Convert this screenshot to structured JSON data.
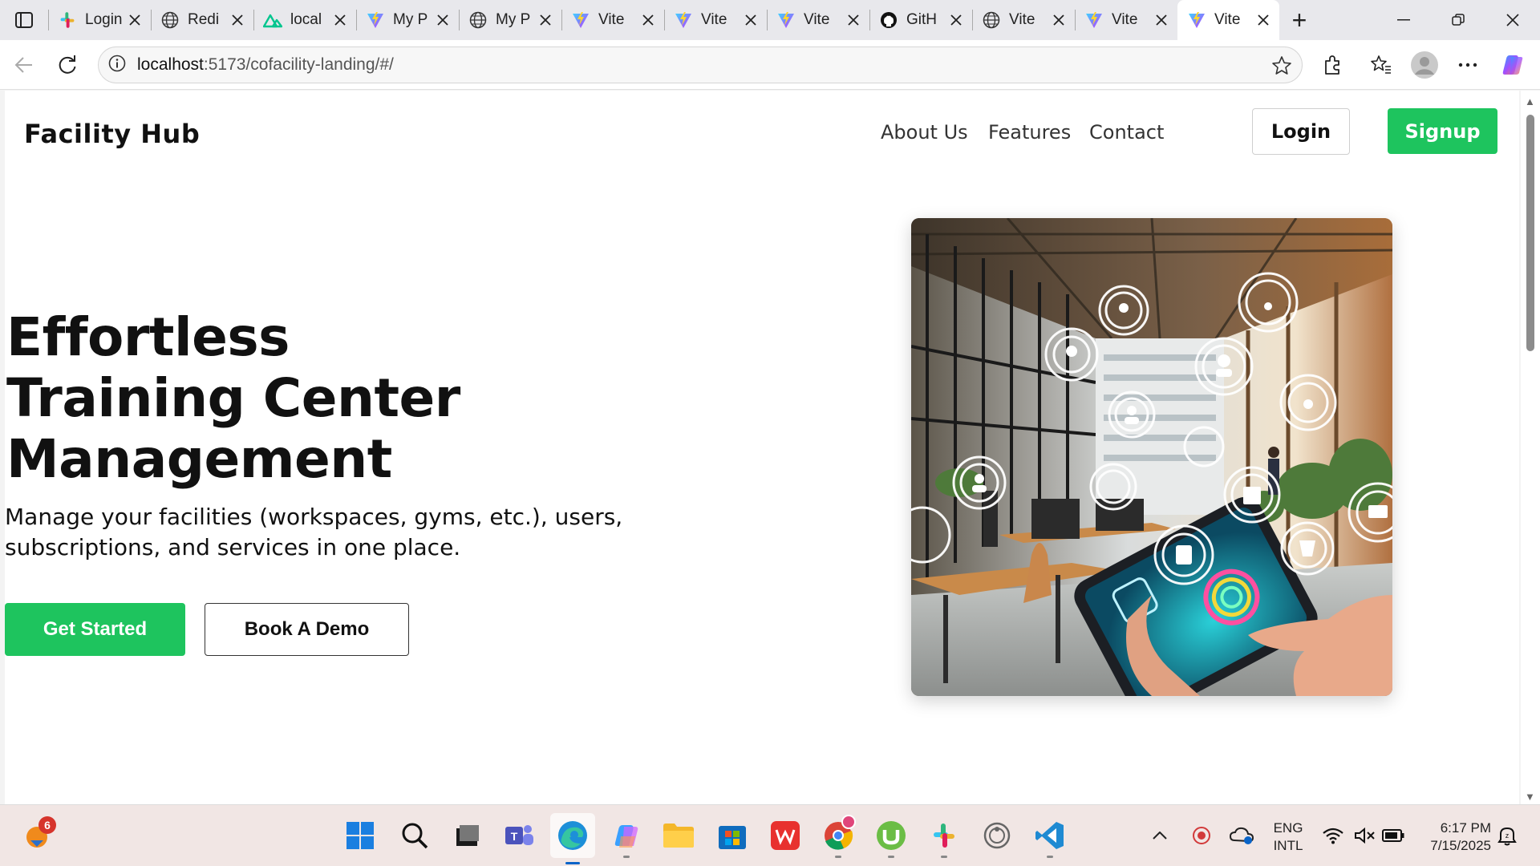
{
  "browser": {
    "tabs": [
      {
        "label": "Login",
        "icon": "slack-icon"
      },
      {
        "label": "Redi",
        "icon": "globe-icon"
      },
      {
        "label": "local",
        "icon": "nuxt-icon"
      },
      {
        "label": "My P",
        "icon": "vite-icon"
      },
      {
        "label": "My P",
        "icon": "globe-icon"
      },
      {
        "label": "Vite",
        "icon": "vite-icon"
      },
      {
        "label": "Vite",
        "icon": "vite-icon"
      },
      {
        "label": "Vite",
        "icon": "vite-icon"
      },
      {
        "label": "GitH",
        "icon": "github-icon"
      },
      {
        "label": "Vite",
        "icon": "globe-icon"
      },
      {
        "label": "Vite",
        "icon": "vite-icon"
      },
      {
        "label": "Vite",
        "icon": "vite-icon",
        "active": true
      }
    ],
    "new_tab": "+",
    "url_host": "localhost",
    "url_path": ":5173/cofacility-landing/#/"
  },
  "site": {
    "brand": "Facility Hub",
    "nav": [
      "About Us",
      "Features",
      "Contact"
    ],
    "login_label": "Login",
    "signup_label": "Signup",
    "accent_color": "#1ec45e"
  },
  "hero": {
    "title_lines": [
      "Effortless",
      "Training Center",
      "Management"
    ],
    "subtitle": "Manage your facilities (workspaces, gyms, etc.), users, subscriptions, and services in one place.",
    "primary_cta": "Get Started",
    "secondary_cta": "Book A Demo"
  },
  "taskbar": {
    "notification_count": "6",
    "lang_top": "ENG",
    "lang_bottom": "INTL",
    "time": "6:17 PM",
    "date": "7/15/2025"
  }
}
